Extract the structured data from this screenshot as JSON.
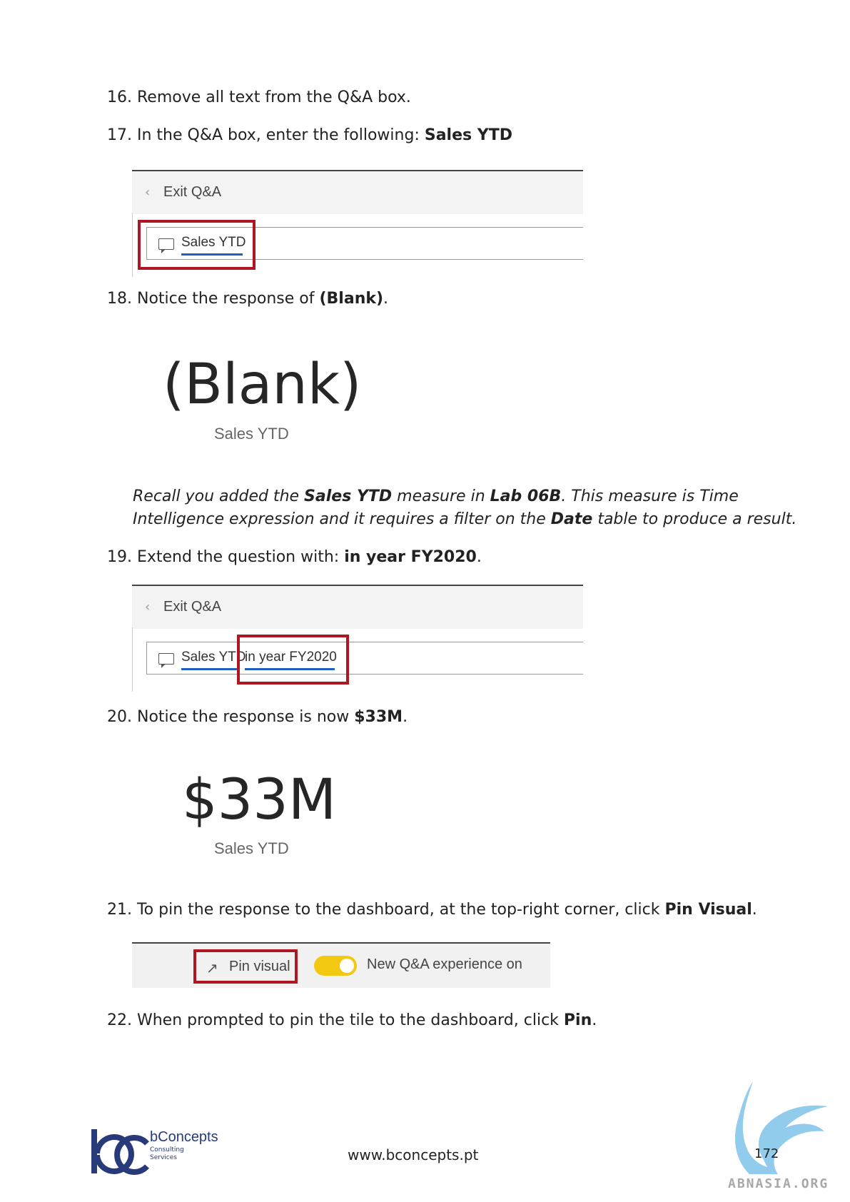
{
  "steps": {
    "s16": "16. Remove all text from the Q&A box.",
    "s17_pre": "17. In the Q&A box, enter the following: ",
    "s17_bold": "Sales YTD",
    "s18_pre": "18. Notice the response of ",
    "s18_bold": "(Blank)",
    "s18_post": ".",
    "s19_pre": "19. Extend the question with: ",
    "s19_bold": "in year FY2020",
    "s19_post": ".",
    "s20_pre": "20. Notice the response is now ",
    "s20_bold": "$33M",
    "s20_post": ".",
    "s21_pre": "21. To pin the response to the dashboard, at the top-right corner, click ",
    "s21_bold": "Pin Visual",
    "s21_post": ".",
    "s22_pre": "22. When prompted to pin the tile to the dashboard, click ",
    "s22_bold": "Pin",
    "s22_post": "."
  },
  "qa1": {
    "exit_label": "Exit Q&A",
    "question": "Sales YTD"
  },
  "card1": {
    "value": "(Blank)",
    "label": "Sales YTD"
  },
  "note": {
    "t1": "Recall you added the ",
    "b1": "Sales YTD",
    "t2": " measure in ",
    "b2": "Lab 06B",
    "t3": ". This measure is Time Intelligence expression and it requires a filter on the ",
    "b3": "Date",
    "t4": " table to produce a result."
  },
  "qa2": {
    "exit_label": "Exit Q&A",
    "question_part1": "Sales YTD",
    "question_part2": "in year FY2020"
  },
  "card2": {
    "value": "$33M",
    "label": "Sales YTD"
  },
  "pinbar": {
    "pin_label": "Pin visual",
    "toggle_label": "New Q&A experience on",
    "toggle_on": true,
    "toggle_color": "#f2c811"
  },
  "footer": {
    "brand": "bConcepts",
    "brand_sub1": "Consulting",
    "brand_sub2": "Services",
    "website": "www.bconcepts.pt",
    "page_number": "172",
    "watermark": "ABNASIA.ORG"
  },
  "colors": {
    "highlight_box": "#b01622",
    "underline": "#1f5fbf",
    "brand": "#283a7a"
  }
}
